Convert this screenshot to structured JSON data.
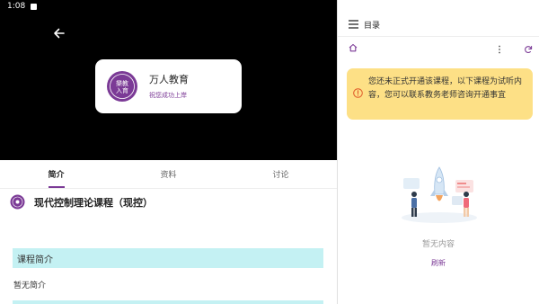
{
  "status_bar": {
    "time": "1:08"
  },
  "brand": {
    "name": "万人教育",
    "slogan": "祝您成功上岸",
    "logo_text": "樂教入育"
  },
  "tabs": [
    {
      "label": "简介"
    },
    {
      "label": "资料"
    },
    {
      "label": "讨论"
    }
  ],
  "course": {
    "title": "现代控制理论课程（现控）"
  },
  "intro": {
    "heading": "课程简介",
    "text": "暂无简介"
  },
  "catalog": {
    "title": "目录",
    "notice": "您还未正式开通该课程，以下课程为试听内容，您可以联系教务老师咨询开通事宜",
    "empty_text": "暂无内容",
    "refresh_label": "刷新"
  },
  "colors": {
    "accent": "#7b3a96",
    "notice_bg": "#fde086",
    "intro_bg": "#c4f1f3"
  }
}
